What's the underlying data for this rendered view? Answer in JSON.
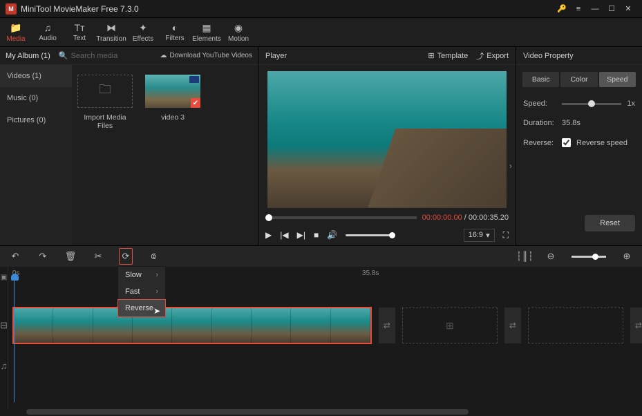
{
  "titlebar": {
    "title": "MiniTool MovieMaker Free 7.3.0"
  },
  "toolbar": {
    "media": "Media",
    "audio": "Audio",
    "text": "Text",
    "transition": "Transition",
    "effects": "Effects",
    "filters": "Filters",
    "elements": "Elements",
    "motion": "Motion"
  },
  "media_head": {
    "album": "My Album (1)",
    "search_ph": "Search media",
    "yt": "Download YouTube Videos"
  },
  "media_cats": {
    "videos": "Videos (1)",
    "music": "Music (0)",
    "pictures": "Pictures (0)"
  },
  "media_items": {
    "import": "Import Media Files",
    "video3": "video 3"
  },
  "player": {
    "label": "Player",
    "template": "Template",
    "export": "Export",
    "time_cur": "00:00:00.00",
    "time_sep": " / ",
    "time_total": "00:00:35.20",
    "aspect": "16:9"
  },
  "props": {
    "title": "Video Property",
    "tab_basic": "Basic",
    "tab_color": "Color",
    "tab_speed": "Speed",
    "speed_lab": "Speed:",
    "speed_val": "1x",
    "dur_lab": "Duration:",
    "dur_val": "35.8s",
    "rev_lab": "Reverse:",
    "rev_chk": "Reverse speed",
    "reset": "Reset"
  },
  "speed_menu": {
    "slow": "Slow",
    "fast": "Fast",
    "reverse": "Reverse"
  },
  "ruler": {
    "t0": "0s",
    "t1": "35.8s"
  }
}
